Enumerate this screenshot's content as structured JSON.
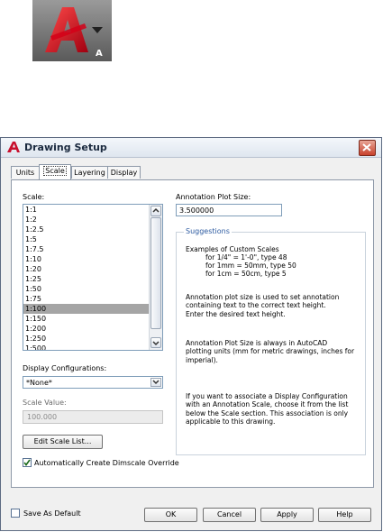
{
  "dialog": {
    "title": "Drawing Setup",
    "tabs": [
      "Units",
      "Scale",
      "Layering",
      "Display"
    ],
    "active_tab": "Scale"
  },
  "scale": {
    "label": "Scale:",
    "items": [
      "1:1",
      "1:2",
      "1:2.5",
      "1:5",
      "1:7.5",
      "1:10",
      "1:20",
      "1:25",
      "1:50",
      "1:75",
      "1:100",
      "1:150",
      "1:200",
      "1:250",
      "1:500"
    ],
    "selected": "1:100"
  },
  "display_config": {
    "label": "Display Configurations:",
    "value": "*None*"
  },
  "scale_value": {
    "label": "Scale Value:",
    "value": "100.000"
  },
  "edit_scale_list_button": "Edit Scale List...",
  "auto_dimscale": {
    "label": "Automatically Create Dimscale Override",
    "checked": true
  },
  "annotation": {
    "label": "Annotation Plot Size:",
    "value": "3.500000"
  },
  "suggestions": {
    "title": "Suggestions",
    "line1": "Examples of Custom Scales",
    "line2": "for 1/4\" = 1'-0\", type 48",
    "line3": "for 1mm = 50mm, type 50",
    "line4": "for 1cm = 50cm, type 5",
    "para2": "Annotation plot size is used to set annotation\ncontaining text to the correct text height.\nEnter the desired text height.",
    "para3": "Annotation Plot Size is always in AutoCAD\nplotting units (mm for metric drawings, inches for\nimperial).",
    "para4": "If you want to associate a Display Configuration\nwith an Annotation Scale, choose it from the list\nbelow the Scale section. This association is only\napplicable to this drawing."
  },
  "footer": {
    "save_default_label": "Save As Default",
    "save_default_checked": false,
    "ok": "OK",
    "cancel": "Cancel",
    "apply": "Apply",
    "help": "Help"
  },
  "colors": {
    "autocad_red": "#c8102e",
    "selection": "#a5a5a5",
    "group_title": "#2c5aa0"
  }
}
